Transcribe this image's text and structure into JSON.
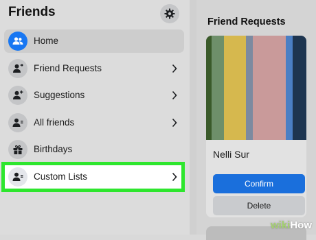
{
  "sidebar": {
    "title": "Friends",
    "items": [
      {
        "label": "Home",
        "icon": "friends-icon"
      },
      {
        "label": "Friend Requests",
        "icon": "person-arrow-icon"
      },
      {
        "label": "Suggestions",
        "icon": "person-plus-icon"
      },
      {
        "label": "All friends",
        "icon": "person-list-icon"
      },
      {
        "label": "Birthdays",
        "icon": "gift-icon"
      },
      {
        "label": "Custom Lists",
        "icon": "person-list-icon"
      }
    ]
  },
  "requests": {
    "title": "Friend Requests",
    "card": {
      "name": "Nelli Sur",
      "confirm_label": "Confirm",
      "delete_label": "Delete"
    }
  },
  "watermark": {
    "wiki": "wiki",
    "how": "How"
  },
  "colors": {
    "accent": "#1877f2",
    "highlight": "#2ee62e",
    "confirm": "#1a6fdc"
  }
}
